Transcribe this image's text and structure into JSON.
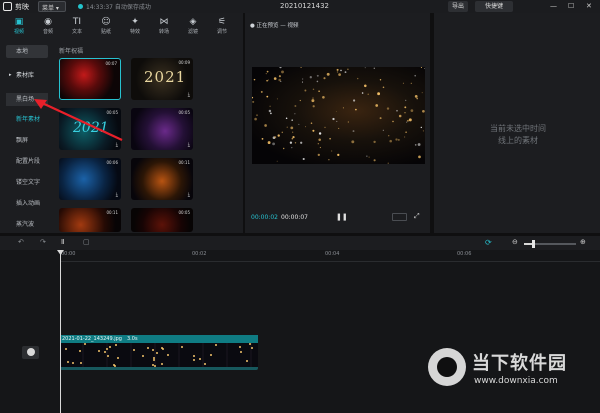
{
  "titlebar": {
    "app_name": "剪映",
    "menu_label": "菜单 ▾",
    "save_status": "14:33:37 自动保存成功",
    "project_title": "20210121432",
    "export_label": "导出",
    "shortcut_label": "快捷键",
    "window_controls": [
      "—",
      "☐",
      "✕"
    ]
  },
  "tool_tabs": [
    {
      "icon": "▣",
      "label": "视频"
    },
    {
      "icon": "◉",
      "label": "音频"
    },
    {
      "icon": "TI",
      "label": "文本"
    },
    {
      "icon": "☺",
      "label": "贴纸"
    },
    {
      "icon": "✦",
      "label": "特效"
    },
    {
      "icon": "⋈",
      "label": "转场"
    },
    {
      "icon": "◈",
      "label": "滤镜"
    },
    {
      "icon": "⚟",
      "label": "调节"
    }
  ],
  "left_nav": {
    "local": "本地",
    "library": "素材库",
    "black_white": "黑白场",
    "anniversary": "新年素材",
    "festival": "飘屏",
    "opening": "配置片段",
    "emoji": "镂空文字",
    "animation": "插入动画",
    "opening2": "蒸汽波"
  },
  "media": {
    "section_title": "新年祝福",
    "thumbs": [
      {
        "duration": "00:07"
      },
      {
        "duration": "00:09",
        "text": "2021"
      },
      {
        "duration": "00:05",
        "text": "2021"
      },
      {
        "duration": "00:05"
      },
      {
        "duration": "00:06"
      },
      {
        "duration": "00:11"
      },
      {
        "duration": "00:11"
      },
      {
        "duration": "00:05"
      }
    ],
    "download_icon": "⤓"
  },
  "player": {
    "title": "● 正在预览 — 视频",
    "time_current": "00:00:02",
    "time_total": "00:00:07",
    "pause_icon": "❚❚",
    "fullscreen_icon": "⤢"
  },
  "properties": {
    "empty_line1": "当前未选中时间",
    "empty_line2": "线上的素材"
  },
  "timeline": {
    "tools": [
      "↶",
      "↷",
      "Ⅱ",
      "▢"
    ],
    "link_icon": "⟳",
    "zoom_out": "⊖",
    "zoom_in": "⊕",
    "ticks": [
      "00:00",
      "00:02",
      "00:04",
      "00:06"
    ],
    "zoom_level": 0.2,
    "clip_name": "2021-01-22_143249.jpg",
    "clip_duration": "3.0s"
  },
  "watermark": {
    "text": "当下软件园",
    "url": "www.downxia.com"
  },
  "colors": {
    "accent": "#27c2d0",
    "clip": "#17585d",
    "annotation": "#e8202a"
  }
}
